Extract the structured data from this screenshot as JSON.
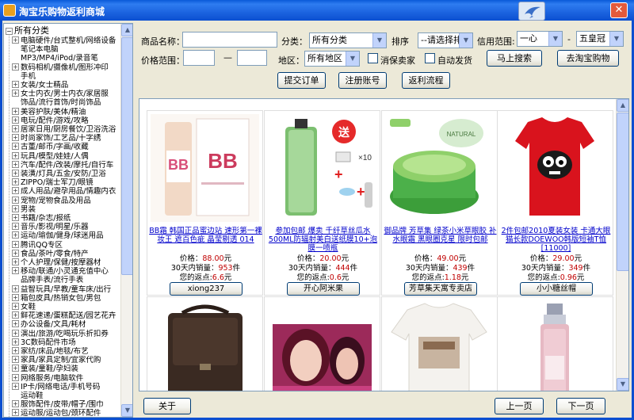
{
  "window": {
    "title": "淘宝乐购物返利商城",
    "close_glyph": "✕",
    "logo_icon": "swallow-bird-icon"
  },
  "tree": {
    "root_label": "所有分类",
    "items": [
      {
        "label": "电脑硬件/台式整机/网络设备",
        "expandable": true
      },
      {
        "label": "笔记本电脑",
        "expandable": false
      },
      {
        "label": "MP3/MP4/iPod/录音笔",
        "expandable": false
      },
      {
        "label": "数码相机/摄像机/图形冲印",
        "expandable": true
      },
      {
        "label": "手机",
        "expandable": false
      },
      {
        "label": "女装/女士精品",
        "expandable": true
      },
      {
        "label": "女士内衣/男士内衣/家居服",
        "expandable": true
      },
      {
        "label": "饰品/流行首饰/时尚饰品",
        "expandable": false
      },
      {
        "label": "美容护肤/美体/精油",
        "expandable": true
      },
      {
        "label": "电玩/配件/游戏/攻略",
        "expandable": true
      },
      {
        "label": "居家日用/厨房餐饮/卫浴洗浴",
        "expandable": true
      },
      {
        "label": "时尚家饰/工艺品/十字绣",
        "expandable": true
      },
      {
        "label": "古董/邮币/字画/收藏",
        "expandable": true
      },
      {
        "label": "玩具/模型/娃娃/人偶",
        "expandable": true
      },
      {
        "label": "汽车/配件/改装/摩托/自行车",
        "expandable": true
      },
      {
        "label": "装潢/灯具/五金/安防/卫浴",
        "expandable": true
      },
      {
        "label": "ZIPPO/瑞士军刀/眼镜",
        "expandable": true
      },
      {
        "label": "成人用品/避孕用品/情趣内衣",
        "expandable": true
      },
      {
        "label": "宠物/宠物食品及用品",
        "expandable": true
      },
      {
        "label": "男装",
        "expandable": true
      },
      {
        "label": "书籍/杂志/报纸",
        "expandable": true
      },
      {
        "label": "音乐/影视/明星/乐器",
        "expandable": true
      },
      {
        "label": "运动/瑜伽/健身/球迷用品",
        "expandable": true
      },
      {
        "label": "腾讯QQ专区",
        "expandable": true
      },
      {
        "label": "食品/茶叶/零食/特产",
        "expandable": true
      },
      {
        "label": "个人护理/保健/按摩器材",
        "expandable": true
      },
      {
        "label": "移动/联通/小灵通充值中心",
        "expandable": true
      },
      {
        "label": "品牌手表/流行手表",
        "expandable": false
      },
      {
        "label": "益智玩具/早教/童车床/出行",
        "expandable": true
      },
      {
        "label": "箱包皮具/热销女包/男包",
        "expandable": true
      },
      {
        "label": "女鞋",
        "expandable": true
      },
      {
        "label": "鲜花速递/蛋糕配送/园艺花卉",
        "expandable": true
      },
      {
        "label": "办公设备/文具/耗材",
        "expandable": true
      },
      {
        "label": "演出/旅游/吃喝玩乐折扣券",
        "expandable": true
      },
      {
        "label": "3C数码配件市场",
        "expandable": true
      },
      {
        "label": "家纺/床品/地毯/布艺",
        "expandable": true
      },
      {
        "label": "家具/家具定制/宜家代购",
        "expandable": true
      },
      {
        "label": "童装/童鞋/孕妇装",
        "expandable": true
      },
      {
        "label": "网络服务/电脑软件",
        "expandable": true
      },
      {
        "label": "IP卡/网络电话/手机号码",
        "expandable": true
      },
      {
        "label": "运动鞋",
        "expandable": false
      },
      {
        "label": "服饰配件/皮带/帽子/围巾",
        "expandable": true
      },
      {
        "label": "运动服/运动包/颈环配件",
        "expandable": true
      }
    ]
  },
  "search": {
    "name_label": "商品名称：",
    "name_value": "",
    "category_label": "分类：",
    "category_value": "所有分类",
    "sort_label": "排序",
    "sort_value": "--请选择排序--",
    "credit_label": "信用范围:",
    "credit_min": "一心",
    "credit_sep": "-",
    "credit_max": "五皇冠",
    "price_label": "价格范围：",
    "price_min": "",
    "price_sep": "—",
    "price_max": "",
    "region_label": "地区：",
    "region_value": "所有地区",
    "consumer_protect_label": "消保卖家",
    "auto_ship_label": "自动发货",
    "search_button": "马上搜索",
    "taobao_button": "去淘宝购物"
  },
  "actions": {
    "submit_order": "提交订单",
    "register": "注册账号",
    "rebate_flow": "返利流程"
  },
  "labels": {
    "price": "价格：",
    "price_unit": "元",
    "sales": "30天内销量：",
    "sales_unit": "件",
    "rebate": "您的返点:",
    "rebate_unit": "元"
  },
  "products": [
    {
      "title": "BB霜 韩国正品蜜边站 速形第一裸妆王 遮百色疵 晶莹剔透 014",
      "price": "88.00",
      "sales": "953",
      "rebate": "6.6",
      "shop": "xiong237",
      "image": "bb-cream-product-photo"
    },
    {
      "title": "参加包邮 爆卖 千纤草丝瓜水500ML防辐射美白送纸膜10+泡膜一喷瓶",
      "price": "20.00",
      "sales": "444",
      "rebate": "0.6",
      "shop": "开心阿米果",
      "image": "toner-bottle-product-photo"
    },
    {
      "title": "御品牌 芳草集 绿茶小米草眼胶 补水眼霜 黑眼圈克星 限时包邮",
      "price": "49.00",
      "sales": "439",
      "rebate": "1.18",
      "shop": "芳草集天寓专卖店",
      "image": "eye-gel-jar-product-photo"
    },
    {
      "title": "2件包邮2010夏装女装 卡通大眼猫长款DOEWOO韩版短袖T恤 [11000]",
      "price": "29.00",
      "sales": "349",
      "rebate": "0.96",
      "shop": "小小糖丝帽",
      "image": "red-tshirt-product-photo"
    },
    {
      "title": "",
      "price": "",
      "sales": "",
      "rebate": "",
      "shop": "",
      "image": "brown-leather-bag-product-photo"
    },
    {
      "title": "",
      "price": "",
      "sales": "",
      "rebate": "",
      "shop": "",
      "image": "makeup-woman-product-photo"
    },
    {
      "title": "",
      "price": "",
      "sales": "",
      "rebate": "",
      "shop": "",
      "image": "white-print-tshirt-product-photo"
    },
    {
      "title": "",
      "price": "",
      "sales": "",
      "rebate": "",
      "shop": "",
      "image": "pink-pump-bottle-product-photo"
    }
  ],
  "footer": {
    "about": "关于",
    "prev": "上一页",
    "next": "下一页"
  },
  "colors": {
    "titlebar": "#0b4fd0",
    "link": "#0000cc",
    "price": "#c00000"
  }
}
